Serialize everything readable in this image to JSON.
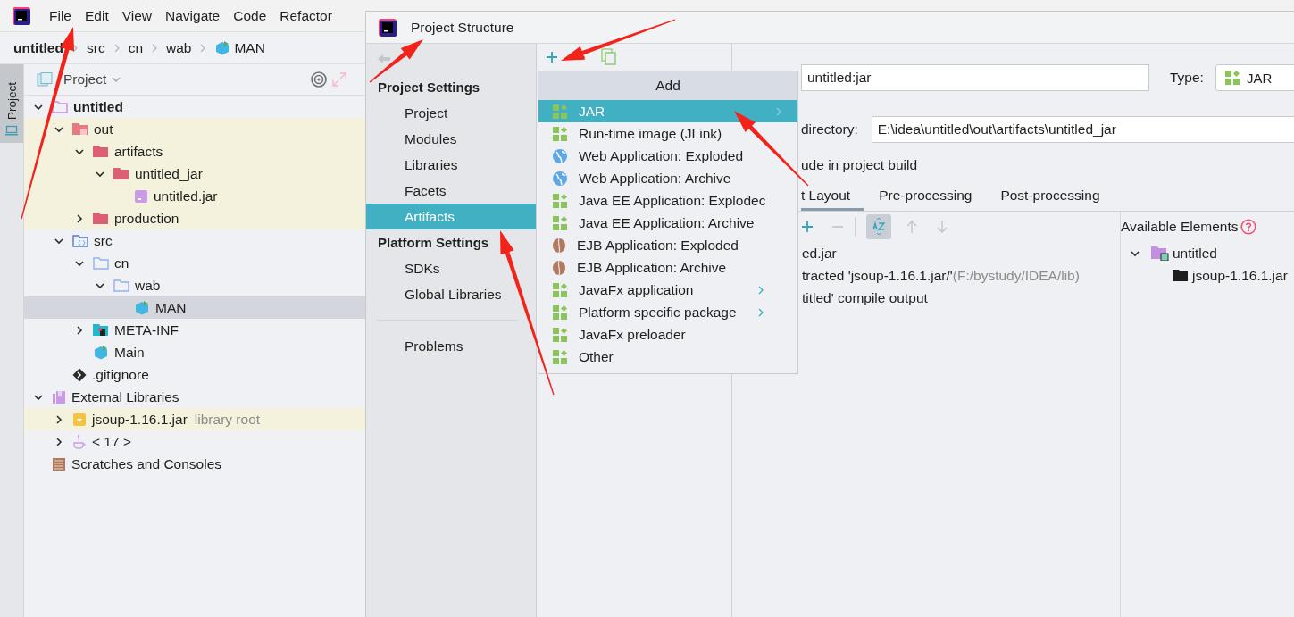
{
  "menu": [
    "File",
    "Edit",
    "View",
    "Navigate",
    "Code",
    "Refactor"
  ],
  "breadcrumb": [
    {
      "label": "untitled",
      "kind": "project"
    },
    {
      "label": "src",
      "kind": "folder"
    },
    {
      "label": "cn",
      "kind": "folder"
    },
    {
      "label": "wab",
      "kind": "folder"
    },
    {
      "label": "MAN",
      "kind": "class"
    }
  ],
  "side_tab": {
    "label": "Project",
    "selected": true
  },
  "project_panel": {
    "title": "Project",
    "tree": [
      {
        "label": "untitled",
        "kind": "module-folder",
        "bold": true,
        "expanded": true,
        "highlighted": false,
        "selected": false,
        "children": [
          {
            "label": "out",
            "kind": "excluded-folder",
            "expanded": true,
            "highlighted": true,
            "selected": false,
            "children": [
              {
                "label": "artifacts",
                "kind": "red-folder",
                "expanded": true,
                "highlighted": true,
                "selected": false,
                "children": [
                  {
                    "label": "untitled_jar",
                    "kind": "red-folder",
                    "expanded": true,
                    "highlighted": true,
                    "selected": false,
                    "children": [
                      {
                        "label": "untitled.jar",
                        "kind": "jar",
                        "highlighted": true,
                        "selected": false
                      }
                    ]
                  }
                ]
              },
              {
                "label": "production",
                "kind": "red-folder",
                "expanded": false,
                "highlighted": true,
                "selected": false
              }
            ]
          },
          {
            "label": "src",
            "kind": "source-folder",
            "expanded": true,
            "highlighted": false,
            "selected": false,
            "children": [
              {
                "label": "cn",
                "kind": "folder",
                "expanded": true,
                "highlighted": false,
                "selected": false,
                "children": [
                  {
                    "label": "wab",
                    "kind": "folder",
                    "expanded": true,
                    "highlighted": false,
                    "selected": false,
                    "children": [
                      {
                        "label": "MAN",
                        "kind": "class",
                        "highlighted": false,
                        "selected": true
                      }
                    ]
                  }
                ]
              },
              {
                "label": "META-INF",
                "kind": "meta-folder",
                "expanded": false,
                "highlighted": false,
                "selected": false
              },
              {
                "label": "Main",
                "kind": "class",
                "highlighted": false,
                "selected": false
              }
            ]
          },
          {
            "label": ".gitignore",
            "kind": "git",
            "highlighted": false,
            "selected": false
          }
        ]
      },
      {
        "label": "External Libraries",
        "kind": "libraries",
        "expanded": true,
        "highlighted": false,
        "selected": false,
        "children": [
          {
            "label": "jsoup-1.16.1.jar",
            "note": "library root",
            "kind": "lib-jar",
            "expanded": false,
            "highlighted": true,
            "selected": false
          },
          {
            "label": "< 17 >",
            "kind": "java",
            "expanded": false,
            "highlighted": false,
            "selected": false
          }
        ]
      },
      {
        "label": "Scratches and Consoles",
        "kind": "scratches",
        "highlighted": false,
        "selected": false
      }
    ]
  },
  "dialog": {
    "title": "Project Structure",
    "nav": [
      {
        "title": "Project Settings",
        "items": [
          {
            "label": "Project",
            "selected": false
          },
          {
            "label": "Modules",
            "selected": false
          },
          {
            "label": "Libraries",
            "selected": false
          },
          {
            "label": "Facets",
            "selected": false
          },
          {
            "label": "Artifacts",
            "selected": true
          }
        ]
      },
      {
        "title": "Platform Settings",
        "items": [
          {
            "label": "SDKs",
            "selected": false
          },
          {
            "label": "Global Libraries",
            "selected": false
          }
        ]
      }
    ],
    "nav_bottom": [
      {
        "label": "Problems",
        "selected": false
      }
    ],
    "add_menu": {
      "title": "Add",
      "items": [
        {
          "label": "JAR",
          "kind": "grid",
          "submenu": true,
          "selected": true
        },
        {
          "label": "Run-time image (JLink)",
          "kind": "grid",
          "submenu": false,
          "selected": false
        },
        {
          "label": "Web Application: Exploded",
          "kind": "globe",
          "submenu": false,
          "selected": false
        },
        {
          "label": "Web Application: Archive",
          "kind": "globe",
          "submenu": false,
          "selected": false
        },
        {
          "label": "Java EE Application: Explodec",
          "kind": "grid",
          "submenu": false,
          "selected": false
        },
        {
          "label": "Java EE Application: Archive",
          "kind": "grid",
          "submenu": false,
          "selected": false
        },
        {
          "label": "EJB Application: Exploded",
          "kind": "bean",
          "submenu": false,
          "selected": false
        },
        {
          "label": "EJB Application: Archive",
          "kind": "bean",
          "submenu": false,
          "selected": false
        },
        {
          "label": "JavaFx application",
          "kind": "grid",
          "submenu": true,
          "selected": false
        },
        {
          "label": "Platform specific package",
          "kind": "grid",
          "submenu": true,
          "selected": false
        },
        {
          "label": "JavaFx preloader",
          "kind": "grid",
          "submenu": false,
          "selected": false
        },
        {
          "label": "Other",
          "kind": "grid",
          "submenu": false,
          "selected": false
        }
      ]
    },
    "name_value": "untitled:jar",
    "type_label": "Type:",
    "type_value": "JAR",
    "dir_label": "directory:",
    "dir_value": "E:\\idea\\untitled\\out\\artifacts\\untitled_jar",
    "build_label": "ude in project build",
    "tabs": [
      {
        "label": "t Layout",
        "selected": true
      },
      {
        "label": "Pre-processing",
        "selected": false
      },
      {
        "label": "Post-processing",
        "selected": false
      }
    ],
    "layout_rows": [
      {
        "text": "ed.jar"
      },
      {
        "text": "tracted 'jsoup-1.16.1.jar/'",
        "note": "(F:/bystudy/IDEA/lib)"
      },
      {
        "text": "titled' compile output"
      }
    ],
    "available": {
      "title": "Available Elements",
      "tree": [
        {
          "label": "untitled",
          "kind": "module-folder",
          "expanded": true,
          "children": [
            {
              "label": "jsoup-1.16.1.jar",
              "kind": "black-folder"
            }
          ]
        }
      ]
    }
  },
  "annotations": [
    {
      "kind": "arrow"
    },
    {
      "kind": "arrow"
    },
    {
      "kind": "arrow"
    },
    {
      "kind": "arrow"
    },
    {
      "kind": "arrow"
    }
  ]
}
